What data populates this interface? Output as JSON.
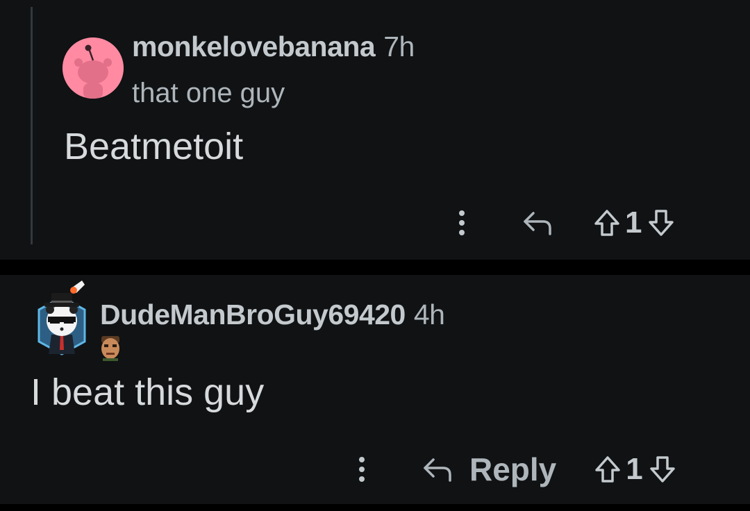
{
  "comments": [
    {
      "author": "monkelovebanana",
      "time": "7h",
      "flair": "that one guy",
      "body": "Beatmetoit",
      "votes": "1",
      "avatar_icon": "snoo-avatar-icon",
      "avatar_color": "#ff8aa2"
    },
    {
      "author": "DudeManBroGuy69420",
      "time": "4h",
      "flair_icon": "doom-face-icon",
      "body": "I beat this guy",
      "reply_label": "Reply",
      "votes": "1",
      "avatar_icon": "panda-hat-avatar-icon"
    }
  ],
  "colors": {
    "background": "#101214",
    "separator": "#000000",
    "username": "#c3c9cd",
    "secondary_text": "#aeb6bb",
    "body_text": "#d7dadc"
  }
}
